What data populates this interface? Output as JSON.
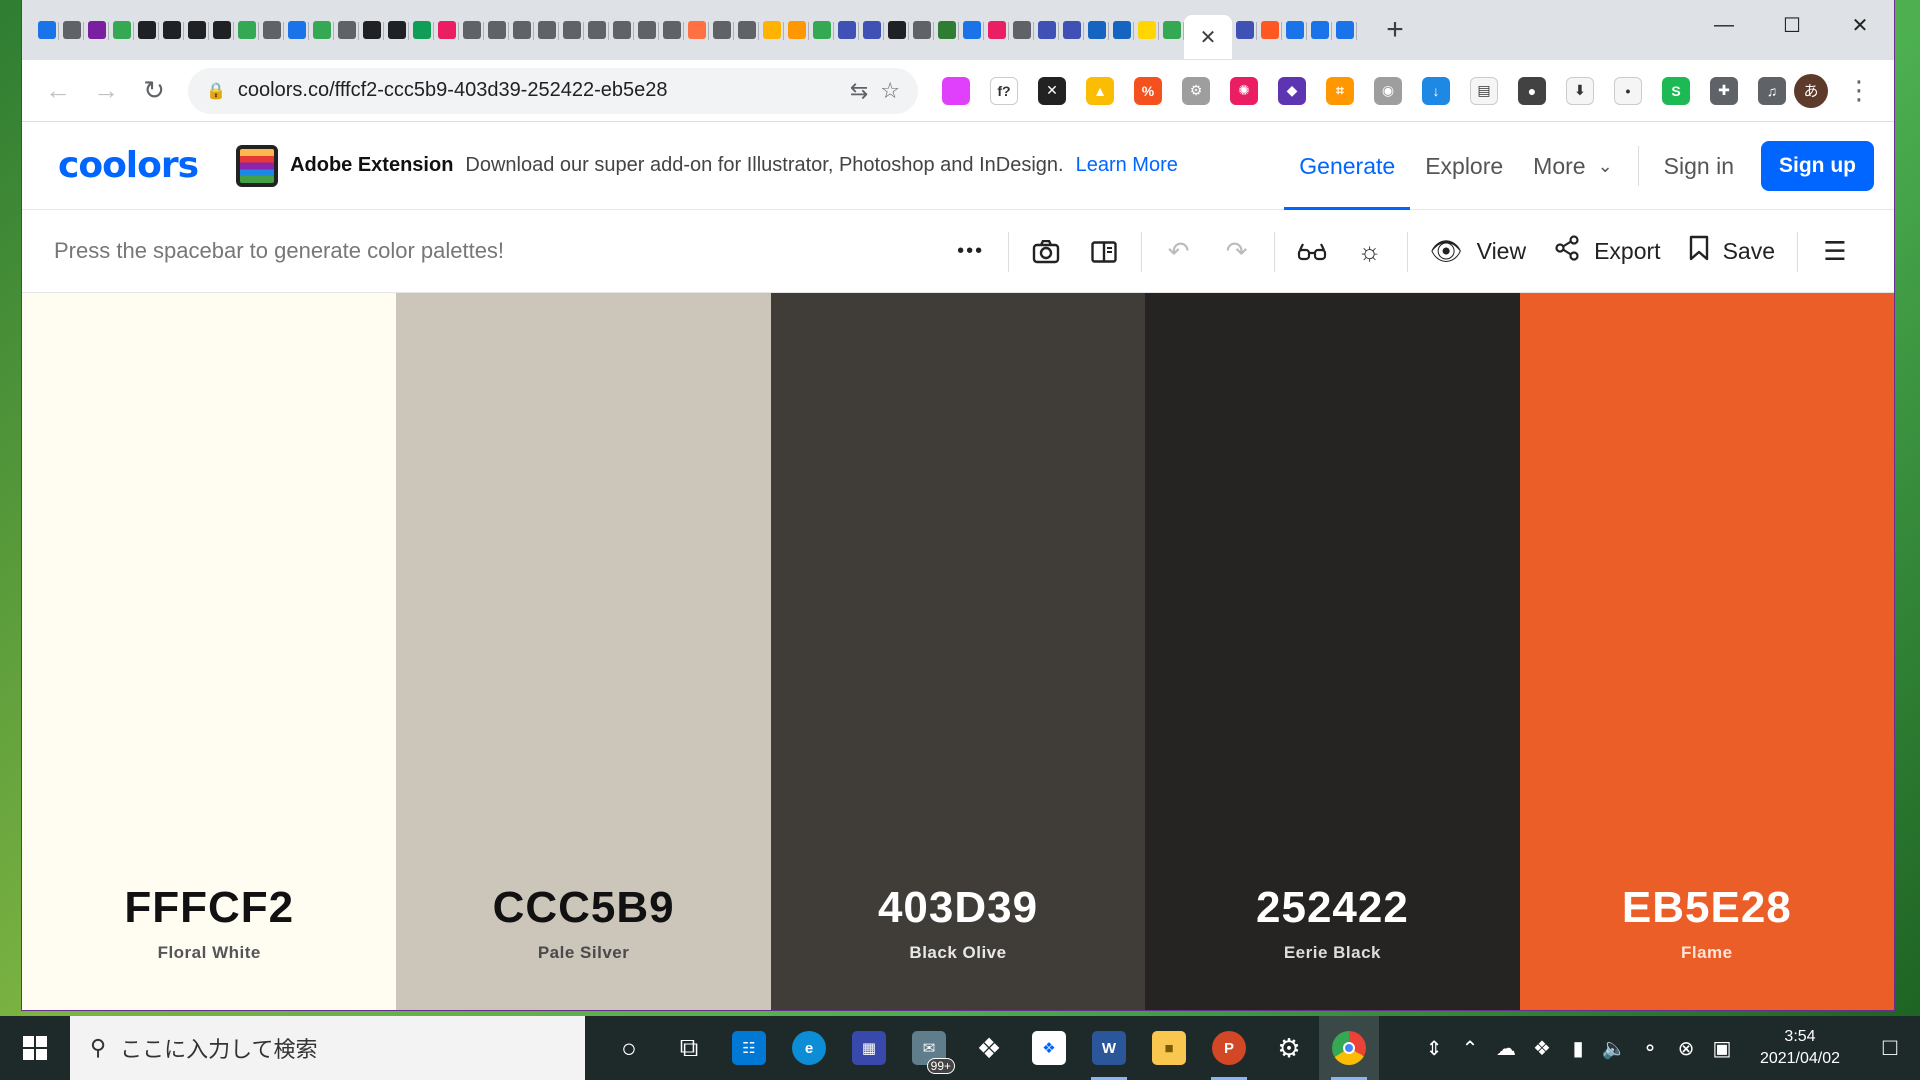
{
  "browser": {
    "tab_colors": [
      "#1a73e8",
      "#5f6368",
      "#7b1fa2",
      "#34a853",
      "#202124",
      "#202124",
      "#202124",
      "#202124",
      "#34a853",
      "#5f6368",
      "#1a73e8",
      "#34a853",
      "#5f6368",
      "#202124",
      "#202124",
      "#0f9d58",
      "#e91e63",
      "#5f6368",
      "#5f6368",
      "#5f6368",
      "#5f6368",
      "#5f6368",
      "#5f6368",
      "#5f6368",
      "#5f6368",
      "#5f6368",
      "#ff7043",
      "#5f6368",
      "#5f6368",
      "#ffb300",
      "#ff9800",
      "#34a853",
      "#3f51b5",
      "#3f51b5",
      "#202124",
      "#5f6368",
      "#2e7d32",
      "#1a73e8",
      "#e91e63",
      "#5f6368",
      "#3f51b5",
      "#3f51b5",
      "#1565c0",
      "#1565c0",
      "#ffd600",
      "#34a853",
      "#3f51b5",
      "#ff5722",
      "#1a73e8",
      "#1a73e8",
      "#1a73e8"
    ],
    "active_tab_close": "✕",
    "new_tab": "+",
    "window_controls": {
      "minimize": "—",
      "maximize": "☐",
      "close": "✕"
    },
    "nav": {
      "back": "←",
      "forward": "→",
      "reload": "↻"
    },
    "url": "coolors.co/fffcf2-ccc5b9-403d39-252422-eb5e28",
    "lock": "🔒",
    "translate_icon": "⇆",
    "bookmark_star": "☆",
    "extensions": [
      {
        "name": "gradient-ext",
        "glyph": "",
        "color": "#e040fb"
      },
      {
        "name": "font-ext",
        "glyph": "f?",
        "color": "#ffffff"
      },
      {
        "name": "x-ext",
        "glyph": "✕",
        "color": "#222222"
      },
      {
        "name": "drive-ext",
        "glyph": "▲",
        "color": "#fbbc04"
      },
      {
        "name": "percent-ext",
        "glyph": "%",
        "color": "#f4511e"
      },
      {
        "name": "gear-ext",
        "glyph": "⚙",
        "color": "#9e9e9e"
      },
      {
        "name": "color-wheel-ext",
        "glyph": "✺",
        "color": "#e91e63"
      },
      {
        "name": "cube-ext",
        "glyph": "◆",
        "color": "#5e35b1"
      },
      {
        "name": "crop-ext",
        "glyph": "⌗",
        "color": "#ff9800"
      },
      {
        "name": "camera-ext",
        "glyph": "◉",
        "color": "#9e9e9e"
      },
      {
        "name": "download-ext",
        "glyph": "↓",
        "color": "#1e88e5"
      },
      {
        "name": "note-ext",
        "glyph": "▤",
        "color": "#f5f5f5"
      },
      {
        "name": "toggle-ext",
        "glyph": "●",
        "color": "#424242"
      },
      {
        "name": "save-ext",
        "glyph": "⬇",
        "color": "#f5f5f5"
      },
      {
        "name": "record-ext",
        "glyph": "•",
        "color": "#f5f5f5"
      },
      {
        "name": "s-ext",
        "glyph": "S",
        "color": "#1db954"
      },
      {
        "name": "puzzle-ext",
        "glyph": "✚",
        "color": "#5f6368"
      },
      {
        "name": "playlist-ext",
        "glyph": "♫",
        "color": "#5f6368"
      }
    ],
    "avatar": "あ",
    "menu": "⋮"
  },
  "site": {
    "logo": "coolors",
    "promo": {
      "title": "Adobe Extension",
      "text": "Download our super add-on for Illustrator, Photoshop and InDesign.",
      "link": "Learn More"
    },
    "nav": {
      "generate": "Generate",
      "explore": "Explore",
      "more": "More",
      "sign_in": "Sign in",
      "sign_up": "Sign up"
    }
  },
  "generator": {
    "hint": "Press the spacebar to generate color palettes!",
    "more_icon": "•••",
    "view_label": "View",
    "export_label": "Export",
    "save_label": "Save"
  },
  "palette": [
    {
      "hex": "FFFCF2",
      "name": "Floral White",
      "bg": "#FFFCF2",
      "fg": "#111111",
      "sub": "#555555"
    },
    {
      "hex": "CCC5B9",
      "name": "Pale Silver",
      "bg": "#CCC5B9",
      "fg": "#111111",
      "sub": "#4a4a4a"
    },
    {
      "hex": "403D39",
      "name": "Black Olive",
      "bg": "#403D39",
      "fg": "#ffffff",
      "sub": "#e8e8e8"
    },
    {
      "hex": "252422",
      "name": "Eerie Black",
      "bg": "#252422",
      "fg": "#ffffff",
      "sub": "#dddddd"
    },
    {
      "hex": "EB5E28",
      "name": "Flame",
      "bg": "#EB5E28",
      "fg": "#ffffff",
      "sub": "#ffe3d6"
    }
  ],
  "taskbar": {
    "search_placeholder": "ここに入力して検索",
    "badge_count": "99+",
    "time": "3:54",
    "date": "2021/04/02"
  }
}
